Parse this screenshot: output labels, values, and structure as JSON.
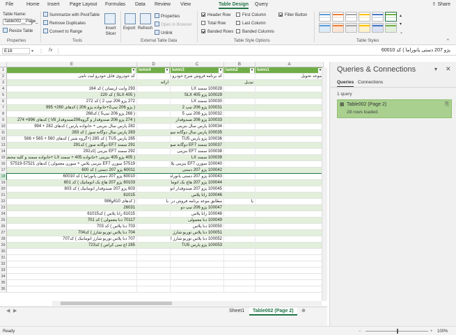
{
  "ribbon_tabs": [
    "File",
    "Home",
    "Insert",
    "Page Layout",
    "Formulas",
    "Data",
    "Review",
    "View",
    "Table Design",
    "Query"
  ],
  "active_tab": "Table Design",
  "share_label": "Share",
  "ribbon": {
    "table_name_label": "Table Name:",
    "table_name_value": "Table002__Page_",
    "resize_table": "Resize Table",
    "group_properties": "Properties",
    "summarize_pivot": "Summarize with PivotTable",
    "remove_duplicates": "Remove Duplicates",
    "convert_to_range": "Convert to Range",
    "insert_slicer": "Insert Slicer",
    "group_tools": "Tools",
    "export": "Export",
    "refresh": "Refresh",
    "properties": "Properties",
    "open_in_browser": "Open in Browser",
    "unlink": "Unlink",
    "group_external": "External Table Data",
    "opt_header_row": "Header Row",
    "opt_total_row": "Total Row",
    "opt_banded_rows": "Banded Rows",
    "opt_first_column": "First Column",
    "opt_last_column": "Last Column",
    "opt_banded_columns": "Banded Columns",
    "opt_filter_button": "Filter Button",
    "group_style_options": "Table Style Options",
    "group_table_styles": "Table Styles"
  },
  "formula_bar": {
    "name_box": "E18",
    "fx": "fx",
    "formula": "پژو 207 دستی پانوراما ) کد 60010"
  },
  "columns": [
    "E",
    "D",
    "C",
    "B",
    "A"
  ],
  "rows": [
    {
      "n": "1",
      "cells": [
        "",
        "lumn4",
        "lumn3",
        "lumn2",
        "lumn1"
      ],
      "hdr": true
    },
    {
      "n": "2",
      "cells": [
        "کد خودروی فابل  خودرو لیت نامی",
        "",
        "کد برنامه فروش  شرح خودرو قابل ارائه",
        "",
        "موعد تحویل"
      ]
    },
    {
      "n": "3",
      "cells": [
        "",
        "ارائه",
        "",
        "تیدیل",
        ""
      ]
    },
    {
      "n": "4",
      "cells": [
        "293 وانت آریسان ) کد 164",
        "",
        "100028 سمند LX",
        "",
        ""
      ]
    },
    {
      "n": "5",
      "cells": [
        "( 405 SLX ) کد 220",
        "",
        "100029 پژو SLX 405",
        "",
        ""
      ]
    },
    {
      "n": "6",
      "cells": [
        "272 پژو 206 تیپ 2 ) کد 272",
        "",
        "100030 سمند LX",
        "",
        ""
      ]
    },
    {
      "n": "7",
      "cells": [
        "( پژو 206 تیپ2+خانواده پژو 206 ) کدهای 260+ 995",
        "",
        "100031 پژو 206 تیپ 2",
        "",
        ""
      ]
    },
    {
      "n": "8",
      "cells": [
        "( 268 پژو 206 تیپ5 ) کد268",
        "",
        "100032 پژو 206 تیپ 5",
        "",
        ""
      ]
    },
    {
      "n": "9",
      "cells": [
        "( 274 پژو 206 صندوقدار و گروه206صندوقدار V8 ) کدهای 996+ 274",
        "",
        "100033 پژو 206 صندوقدار",
        "",
        ""
      ]
    },
    {
      "n": "10",
      "cells": [
        "282 پارس سال بنزینی + خانواده پارس ) کدهای 282 + 994",
        "",
        "100034 پارس سال بنزینی",
        "",
        ""
      ]
    },
    {
      "n": "11",
      "cells": [
        "283 پارس سال دوگانه سوز ) کد 283",
        "",
        "100035 پارس سال دوگانه سوز",
        "",
        ""
      ]
    },
    {
      "n": "12",
      "cells": [
        "285 پارس TU5 ) کد 285 (+گروه شتر ) کدهای 560 + 565 + 566",
        "",
        "100036 پژو پارس TU5",
        "",
        ""
      ]
    },
    {
      "n": "13",
      "cells": [
        "291 سمند EF7 دوگانه سوز ) کد291",
        "",
        "100037 سمند EF7 دوگانه سوز",
        "",
        ""
      ]
    },
    {
      "n": "14",
      "cells": [
        "292 سمند EF7 بنزینی )کد292",
        "",
        "100038 سمند EF7 بنزینی",
        "",
        ""
      ]
    },
    {
      "n": "15",
      "cells": [
        "( 405 پژو 405 بنزینی +خانواده 405 + سمند LX +خانواده سمند و کلیه محصولات",
        "",
        "100039 سمند LX",
        "",
        ""
      ]
    },
    {
      "n": "16",
      "cells": [
        "57519 سورن EF7 بنزینی پلاس + سورن معمولی ) کدهای 57521-57519",
        "",
        "100040 سورن EF7 بنزینی پلاس",
        "",
        ""
      ]
    },
    {
      "n": "17",
      "cells": [
        "60011 پژو 207 دستی ) کد 600",
        "",
        "100042 پژو 207 دستی",
        "",
        ""
      ]
    },
    {
      "n": "18",
      "cells": [
        "60010 پژو 207 دستی پانوراما ) کد 60010",
        "",
        "100043 پژو 207 دستی پانوراما",
        "",
        ""
      ],
      "sel": true
    },
    {
      "n": "19",
      "cells": [
        "60103 پژو 207 هاچ بک اتوماتیک ) کد 601",
        "",
        "100044 پژو 207 هاچ بک اتوماتیک",
        "",
        ""
      ]
    },
    {
      "n": "20",
      "cells": [
        "603 پژو 207 صندوقدار اتوماتیک ) کد 603",
        "",
        "100045 پژو 207 صندوقدار اتوماتیک",
        "",
        ""
      ]
    },
    {
      "n": "21",
      "cells": [
        "61015",
        "",
        "100046 رانا پلاس",
        "",
        ""
      ]
    },
    {
      "n": "22",
      "cells": [
        "( کدهای 610و986",
        "یا",
        "مطابق موعد برنامه فروش در سیستم",
        "یا",
        ""
      ]
    },
    {
      "n": "23",
      "cells": [
        "26031",
        "",
        "100047 پژو 206 تیپ دو",
        "",
        ""
      ]
    },
    {
      "n": "24",
      "cells": [
        "61015 رانا پلاس ) کد61015",
        "",
        "100048 رانا پلاس",
        "",
        ""
      ]
    },
    {
      "n": "25",
      "cells": [
        "70117 دنا معمولی ) کد 701",
        "",
        "100049 دنا معمولی",
        "",
        ""
      ]
    },
    {
      "n": "26",
      "cells": [
        "703 دنا پلاس ) کد 703",
        "",
        "100050 دنا پلاس",
        "",
        ""
      ]
    },
    {
      "n": "27",
      "cells": [
        "704 دنا پلاس توربو شارژ ) کد704",
        "",
        "100051 دنا پلاس توربو شارژ",
        "",
        ""
      ]
    },
    {
      "n": "28",
      "cells": [
        "707 دنا پلاس توربو شارژ اتوماتیک ) کد707",
        "",
        "100052 دنا پلاس توربو شارژ اتوماتیک",
        "",
        ""
      ]
    },
    {
      "n": "29",
      "cells": [
        "285 اچ سی کراس ) کد723",
        "",
        "100053 پژو پارس TU5",
        "",
        ""
      ]
    },
    {
      "n": "30",
      "cells": [
        "",
        "",
        "",
        "",
        ""
      ]
    },
    {
      "n": "31",
      "cells": [
        "",
        "",
        "",
        "",
        ""
      ]
    },
    {
      "n": "32",
      "cells": [
        "",
        "",
        "",
        "",
        ""
      ]
    },
    {
      "n": "33",
      "cells": [
        "",
        "",
        "",
        "",
        ""
      ]
    },
    {
      "n": "34",
      "cells": [
        "",
        "",
        "",
        "",
        ""
      ]
    },
    {
      "n": "35",
      "cells": [
        "",
        "",
        "",
        "",
        ""
      ]
    },
    {
      "n": "36",
      "cells": [
        "",
        "",
        "",
        "",
        ""
      ]
    }
  ],
  "sheet_tabs": [
    "Sheet1",
    "Table002 (Page 2)"
  ],
  "active_sheet": "Table002 (Page 2)",
  "status_text": "Ready",
  "zoom_text": "100%",
  "pane": {
    "title": "Queries & Connections",
    "tab_queries": "Queries",
    "tab_connections": "Connections",
    "count": "1 query",
    "query_name": "Table002 (Page 2)",
    "query_status": "28 rows loaded."
  }
}
